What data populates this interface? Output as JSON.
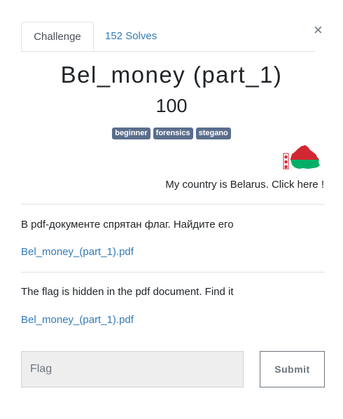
{
  "tabs": {
    "challenge": "Challenge",
    "solves": "152 Solves"
  },
  "close_glyph": "×",
  "challenge": {
    "title": "Bel_money (part_1)",
    "points": "100",
    "tags": [
      "beginner",
      "forensics",
      "stegano"
    ],
    "country_link": "My country is Belarus. Click here !",
    "description_ru": "В pdf-документе спрятан флаг. Найдите его",
    "file_ru": "Bel_money_(part_1).pdf",
    "description_en": "The flag is hidden in the pdf document. Find it",
    "file_en": "Bel_money_(part_1).pdf"
  },
  "form": {
    "flag_placeholder": "Flag",
    "submit_label": "Submit"
  },
  "colors": {
    "tag_bg": "#5a6e8c",
    "link": "#337ab7",
    "flag_red": "#d22730",
    "flag_green": "#00af66"
  }
}
